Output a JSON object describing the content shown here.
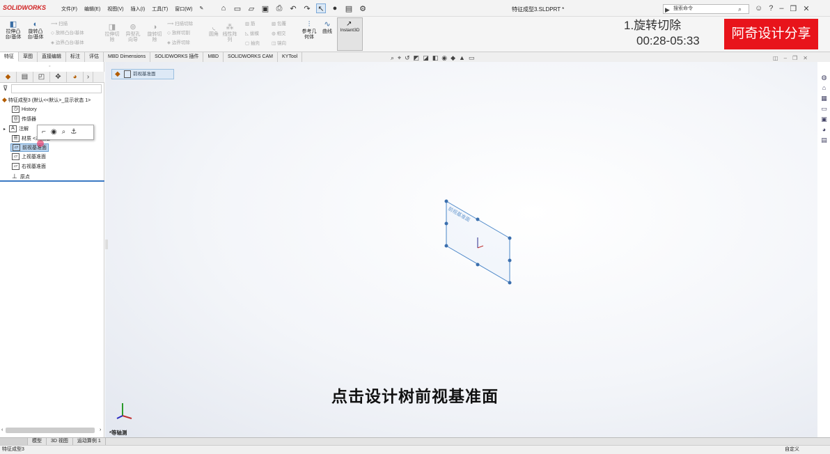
{
  "app": {
    "logo": "SOLIDWORKS",
    "doc_title": "特征成型3.SLDPRT *"
  },
  "menu": [
    "文件(F)",
    "编辑(E)",
    "视图(V)",
    "插入(I)",
    "工具(T)",
    "窗口(W)"
  ],
  "search": {
    "placeholder": "搜索命令"
  },
  "ribbon": {
    "extrude": "拉伸凸\n台/基体",
    "revolve": "旋转凸\n台/基体",
    "sweep": "扫描",
    "loft": "放样凸台/基体",
    "boundary": "边界凸台/基体",
    "ext_cut": "拉伸切\n除",
    "hole": "异型孔\n向导",
    "rev_cut": "旋转切\n除",
    "sweep_cut": "扫描切除",
    "loft_cut": "放样切割",
    "boundary_cut": "边界切除",
    "fillet": "圆角",
    "pattern": "线性阵\n列",
    "rib": "筋",
    "draft": "拔模",
    "shell": "抽壳",
    "wrap": "包覆",
    "intersect": "相交",
    "mirror": "镜向",
    "ref_geom": "参考几\n何体",
    "curves": "曲线",
    "instant3d": "Instant3D"
  },
  "overlay": {
    "step": "1.旋转切除",
    "time": "00:28-05:33",
    "brand": "阿奇设计分享"
  },
  "tabs": [
    "特征",
    "草图",
    "直接编辑",
    "标注",
    "评估",
    "MBD Dimensions",
    "SOLIDWORKS 插件",
    "MBD",
    "SOLIDWORKS CAM",
    "KYTool"
  ],
  "tree": {
    "root": "特征成型3 (默认<<默认>_显示状态 1>",
    "items": [
      "History",
      "传感器",
      "注解",
      "材质 <未指定>",
      "前视基准面",
      "上视基准面",
      "右视基准面",
      "原点"
    ]
  },
  "breadcrumb": "前视基准面",
  "plane_label": "前视基准面",
  "subtitle": "点击设计树前视基准面",
  "view_label": "*等轴测",
  "bottom_tabs": [
    "模型",
    "3D 视图",
    "运动算例 1"
  ],
  "status": {
    "left": "特征成型3",
    "right": "自定义"
  }
}
